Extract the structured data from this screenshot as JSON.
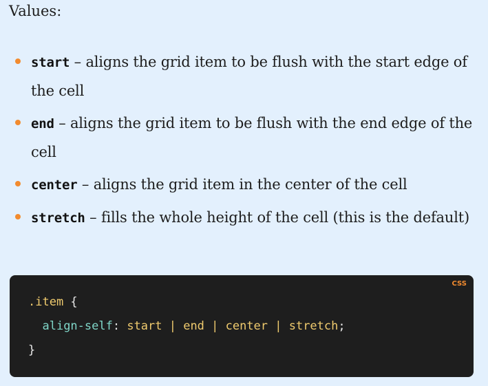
{
  "values_heading": "Values:",
  "items": [
    {
      "term": "start",
      "description": " – aligns the grid item to be flush with the start edge of the cell"
    },
    {
      "term": "end",
      "description": " – aligns the grid item to be flush with the end edge of the cell"
    },
    {
      "term": "center",
      "description": " – aligns the grid item in the center of the cell"
    },
    {
      "term": "stretch",
      "description": " – fills the whole height of the cell (this is the default)"
    }
  ],
  "code": {
    "language": "CSS",
    "selector": ".item",
    "open_brace": " {",
    "indent": "  ",
    "property": "align-self",
    "colon": ": ",
    "value": "start | end | center | stretch",
    "semicolon": ";",
    "close_brace": "}"
  },
  "colors": {
    "page_background": "#e3f0fd",
    "bullet": "#f28b2f",
    "code_background": "#1e1e1e",
    "code_selector": "#f0cb6e",
    "code_property": "#7fd6c8",
    "code_value": "#f0cb6e",
    "language_badge": "#f28b2f"
  }
}
